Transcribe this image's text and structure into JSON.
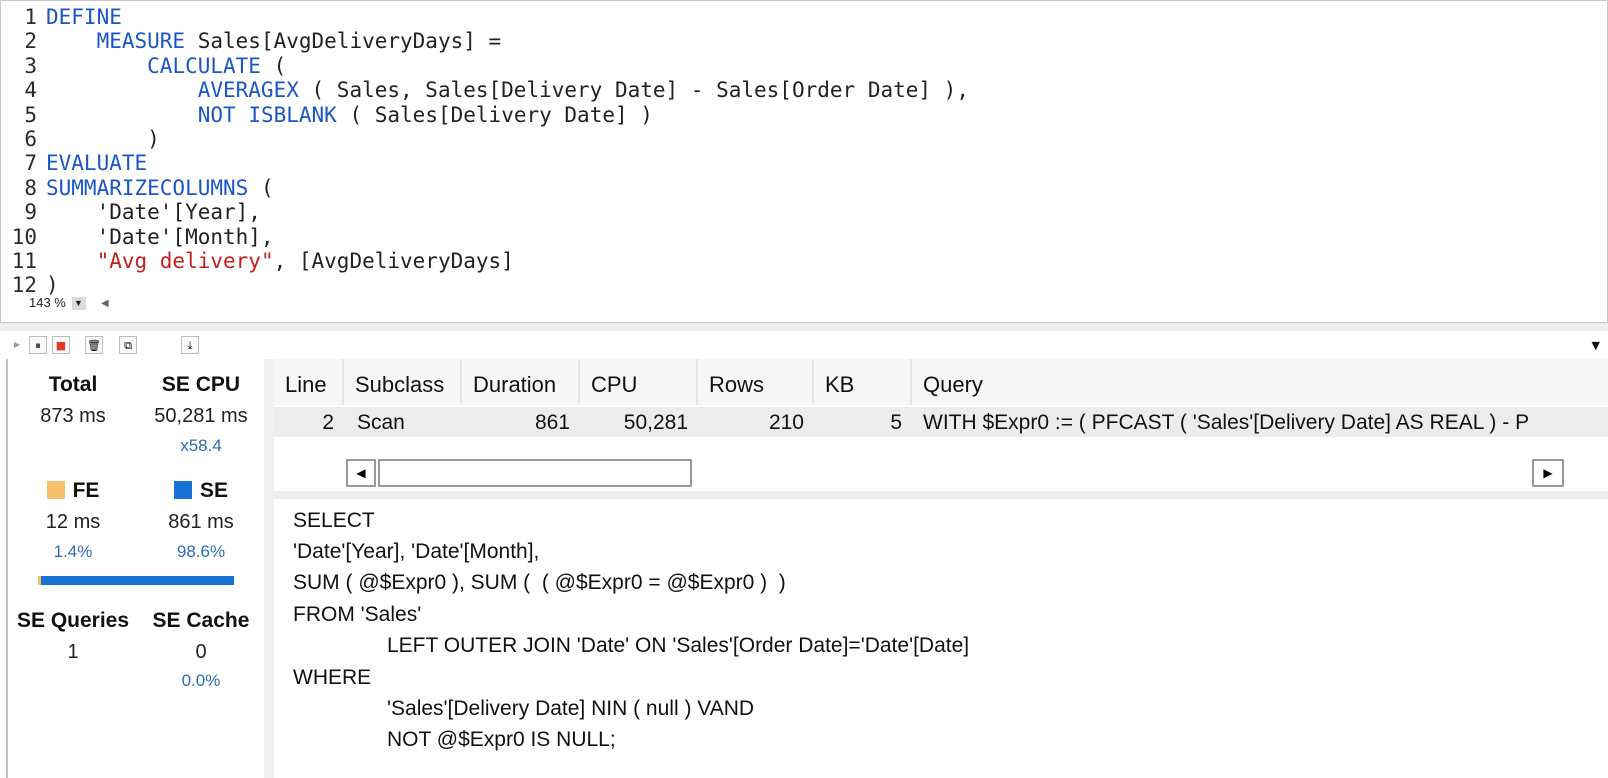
{
  "editor": {
    "lines": [
      {
        "n": "1",
        "parts": [
          {
            "t": "DEFINE",
            "c": "kw"
          }
        ]
      },
      {
        "n": "2",
        "parts": [
          {
            "t": "    "
          },
          {
            "t": "MEASURE",
            "c": "kw"
          },
          {
            "t": " Sales[AvgDeliveryDays] ="
          }
        ]
      },
      {
        "n": "3",
        "parts": [
          {
            "t": "        "
          },
          {
            "t": "CALCULATE",
            "c": "kw"
          },
          {
            "t": " ("
          }
        ]
      },
      {
        "n": "4",
        "parts": [
          {
            "t": "            "
          },
          {
            "t": "AVERAGEX",
            "c": "kw"
          },
          {
            "t": " ( Sales, Sales[Delivery Date] - Sales[Order Date] ),"
          }
        ]
      },
      {
        "n": "5",
        "parts": [
          {
            "t": "            "
          },
          {
            "t": "NOT",
            "c": "kw"
          },
          {
            "t": " "
          },
          {
            "t": "ISBLANK",
            "c": "kw"
          },
          {
            "t": " ( Sales[Delivery Date] )"
          }
        ]
      },
      {
        "n": "6",
        "parts": [
          {
            "t": "        )"
          }
        ]
      },
      {
        "n": "7",
        "parts": [
          {
            "t": "EVALUATE",
            "c": "kw"
          }
        ]
      },
      {
        "n": "8",
        "parts": [
          {
            "t": "SUMMARIZECOLUMNS",
            "c": "kw"
          },
          {
            "t": " ("
          }
        ]
      },
      {
        "n": "9",
        "parts": [
          {
            "t": "    'Date'[Year],"
          }
        ]
      },
      {
        "n": "10",
        "parts": [
          {
            "t": "    'Date'[Month],"
          }
        ]
      },
      {
        "n": "11",
        "parts": [
          {
            "t": "    "
          },
          {
            "t": "\"Avg delivery\"",
            "c": "str"
          },
          {
            "t": ", [AvgDeliveryDays]"
          }
        ]
      },
      {
        "n": "12",
        "parts": [
          {
            "t": ")"
          }
        ]
      }
    ],
    "zoom": "143 %"
  },
  "toolbar": {
    "buttons": [
      {
        "name": "run-icon",
        "glyph": "▶"
      },
      {
        "name": "pause-icon",
        "glyph": "⏸"
      },
      {
        "name": "stop-icon",
        "glyph": "■"
      },
      {
        "name": "clear-icon",
        "glyph": "🗑"
      },
      {
        "name": "copy-icon",
        "glyph": "⧉"
      },
      {
        "name": "export-icon",
        "glyph": "⤓"
      }
    ],
    "collapse_glyph": "▼"
  },
  "stats": {
    "total_label": "Total",
    "total_value": "873 ms",
    "se_cpu_label": "SE CPU",
    "se_cpu_value": "50,281 ms",
    "se_cpu_factor": "x58.4",
    "fe_label": "FE",
    "se_label": "SE",
    "fe_value": "12 ms",
    "se_value": "861 ms",
    "fe_pct": "1.4%",
    "se_pct": "98.6%",
    "fe_fraction": 0.014,
    "fe_color": "#f7c06a",
    "se_color": "#1672d4",
    "se_queries_label": "SE Queries",
    "se_queries_value": "1",
    "se_cache_label": "SE Cache",
    "se_cache_value": "0",
    "se_cache_pct": "0.0%"
  },
  "grid": {
    "columns": [
      "Line",
      "Subclass",
      "Duration",
      "CPU",
      "Rows",
      "KB",
      "Query"
    ],
    "row": {
      "line": "2",
      "subclass": "Scan",
      "duration": "861",
      "cpu": "50,281",
      "rows": "210",
      "kb": "5",
      "query": "WITH $Expr0 := ( PFCAST ( 'Sales'[Delivery Date] AS  REAL ) - P"
    }
  },
  "query": {
    "lines": [
      "SELECT",
      "'Date'[Year], 'Date'[Month],",
      "SUM ( @$Expr0 ), SUM (  ( @$Expr0 = @$Expr0 )  )",
      "FROM 'Sales'",
      "LEFT OUTER JOIN 'Date' ON 'Sales'[Order Date]='Date'[Date]",
      "WHERE",
      "'Sales'[Delivery Date] NIN ( null ) VAND",
      "NOT @$Expr0 IS NULL;"
    ]
  }
}
